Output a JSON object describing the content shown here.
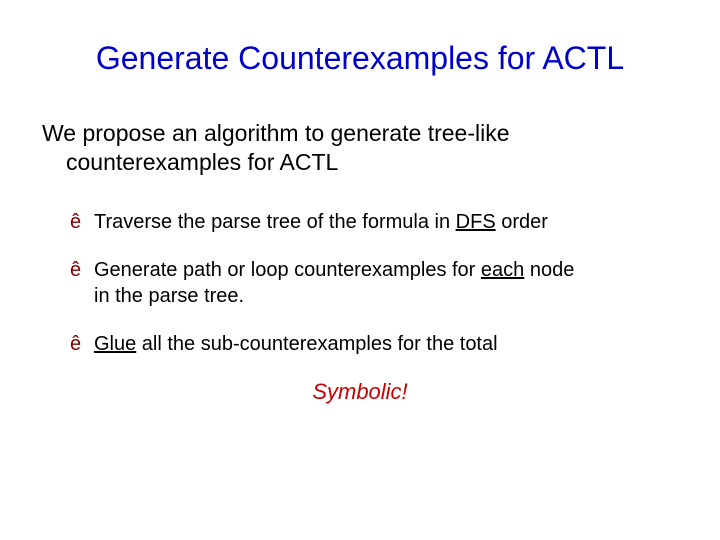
{
  "title": "Generate Counterexamples for ACTL",
  "intro_line1": "We propose an algorithm to generate tree-like",
  "intro_line2": "counterexamples for ACTL",
  "bullets": [
    {
      "pre": "Traverse the parse tree of the formula in ",
      "u": "DFS",
      "post": " order"
    },
    {
      "pre": "Generate path or loop counterexamples for ",
      "u": "each",
      "post": " node",
      "cont": "in the parse tree."
    },
    {
      "u": "Glue",
      "post": " all the sub-counterexamples for the total"
    }
  ],
  "callout": "Symbolic!",
  "glyphs": {
    "arrow": "ê"
  }
}
